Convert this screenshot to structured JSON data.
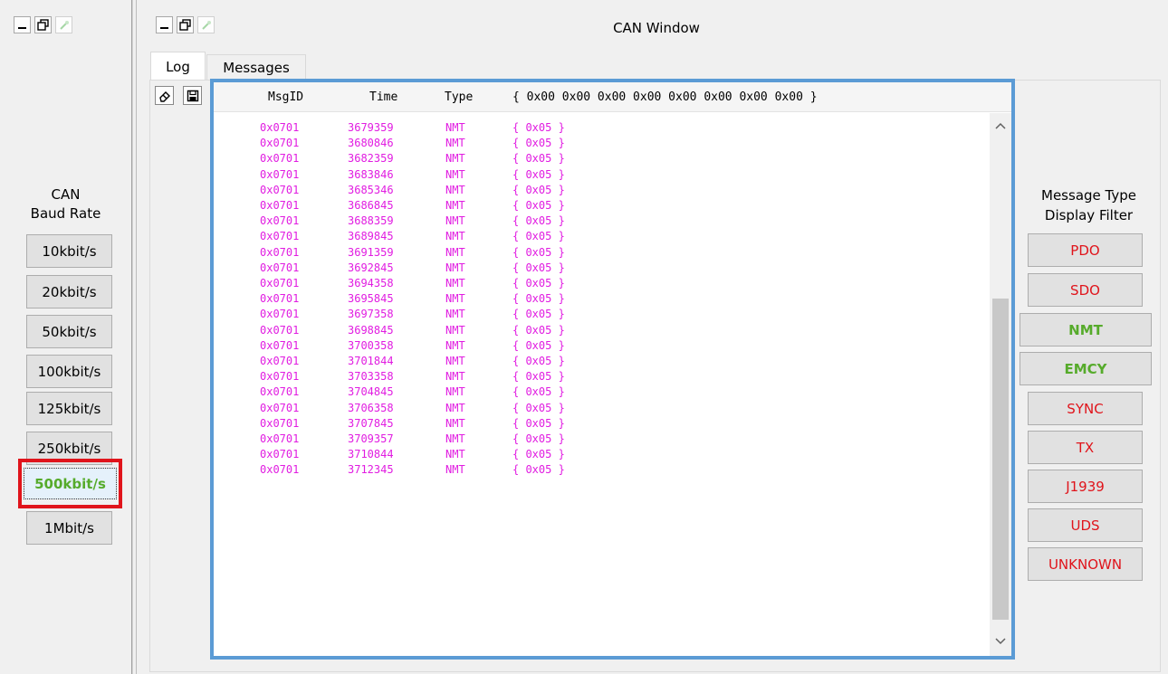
{
  "window_title": "CAN Window",
  "tabs": [
    "Log",
    "Messages"
  ],
  "baud": {
    "title_line1": "CAN",
    "title_line2": "Baud Rate",
    "options": [
      "10kbit/s",
      "20kbit/s",
      "50kbit/s",
      "100kbit/s",
      "125kbit/s",
      "250kbit/s",
      "500kbit/s",
      "1Mbit/s"
    ],
    "selected": "500kbit/s"
  },
  "log": {
    "headers": {
      "msgid": "MsgID",
      "time": "Time",
      "type": "Type",
      "data": "{ 0x00 0x00 0x00 0x00 0x00 0x00 0x00 0x00 }"
    },
    "text_color": "#e11ce1",
    "rows": [
      {
        "id": "0x0701",
        "time": "3679359",
        "type": "NMT",
        "data": "{ 0x05 }"
      },
      {
        "id": "0x0701",
        "time": "3680846",
        "type": "NMT",
        "data": "{ 0x05 }"
      },
      {
        "id": "0x0701",
        "time": "3682359",
        "type": "NMT",
        "data": "{ 0x05 }"
      },
      {
        "id": "0x0701",
        "time": "3683846",
        "type": "NMT",
        "data": "{ 0x05 }"
      },
      {
        "id": "0x0701",
        "time": "3685346",
        "type": "NMT",
        "data": "{ 0x05 }"
      },
      {
        "id": "0x0701",
        "time": "3686845",
        "type": "NMT",
        "data": "{ 0x05 }"
      },
      {
        "id": "0x0701",
        "time": "3688359",
        "type": "NMT",
        "data": "{ 0x05 }"
      },
      {
        "id": "0x0701",
        "time": "3689845",
        "type": "NMT",
        "data": "{ 0x05 }"
      },
      {
        "id": "0x0701",
        "time": "3691359",
        "type": "NMT",
        "data": "{ 0x05 }"
      },
      {
        "id": "0x0701",
        "time": "3692845",
        "type": "NMT",
        "data": "{ 0x05 }"
      },
      {
        "id": "0x0701",
        "time": "3694358",
        "type": "NMT",
        "data": "{ 0x05 }"
      },
      {
        "id": "0x0701",
        "time": "3695845",
        "type": "NMT",
        "data": "{ 0x05 }"
      },
      {
        "id": "0x0701",
        "time": "3697358",
        "type": "NMT",
        "data": "{ 0x05 }"
      },
      {
        "id": "0x0701",
        "time": "3698845",
        "type": "NMT",
        "data": "{ 0x05 }"
      },
      {
        "id": "0x0701",
        "time": "3700358",
        "type": "NMT",
        "data": "{ 0x05 }"
      },
      {
        "id": "0x0701",
        "time": "3701844",
        "type": "NMT",
        "data": "{ 0x05 }"
      },
      {
        "id": "0x0701",
        "time": "3703358",
        "type": "NMT",
        "data": "{ 0x05 }"
      },
      {
        "id": "0x0701",
        "time": "3704845",
        "type": "NMT",
        "data": "{ 0x05 }"
      },
      {
        "id": "0x0701",
        "time": "3706358",
        "type": "NMT",
        "data": "{ 0x05 }"
      },
      {
        "id": "0x0701",
        "time": "3707845",
        "type": "NMT",
        "data": "{ 0x05 }"
      },
      {
        "id": "0x0701",
        "time": "3709357",
        "type": "NMT",
        "data": "{ 0x05 }"
      },
      {
        "id": "0x0701",
        "time": "3710844",
        "type": "NMT",
        "data": "{ 0x05 }"
      },
      {
        "id": "0x0701",
        "time": "3712345",
        "type": "NMT",
        "data": "{ 0x05 }"
      }
    ]
  },
  "filter": {
    "title_line1": "Message Type",
    "title_line2": "Display Filter",
    "items": [
      {
        "label": "PDO",
        "color": "red"
      },
      {
        "label": "SDO",
        "color": "red"
      },
      {
        "label": "NMT",
        "color": "green"
      },
      {
        "label": "EMCY",
        "color": "green"
      },
      {
        "label": "SYNC",
        "color": "red"
      },
      {
        "label": "TX",
        "color": "red"
      },
      {
        "label": "J1939",
        "color": "red"
      },
      {
        "label": "UDS",
        "color": "red"
      },
      {
        "label": "UNKNOWN",
        "color": "red"
      }
    ]
  },
  "colors": {
    "highlight_red": "#e0141b",
    "frame_blue": "#5b9bd5",
    "active_green": "#56ab2b"
  }
}
